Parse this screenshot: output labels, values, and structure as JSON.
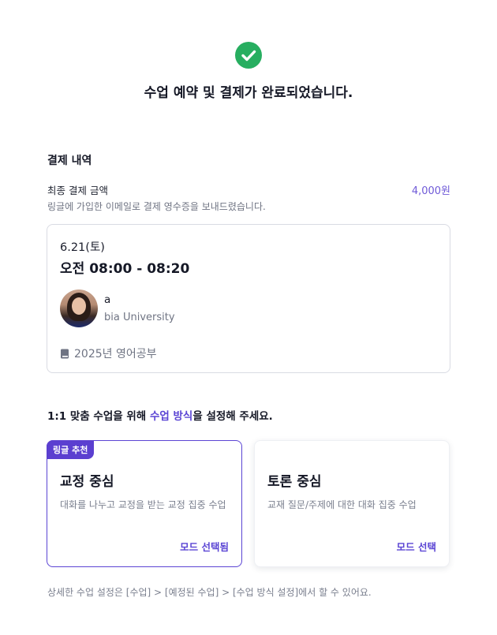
{
  "header": {
    "icon": "check-circle-icon",
    "title": "수업 예약 및 결제가 완료되었습니다."
  },
  "payment": {
    "section_title": "결제 내역",
    "final_label": "최종 결제 금액",
    "final_amount": "4,000원",
    "receipt_note": "링글에 가입한 이메일로 결제 영수증을 보내드렸습니다."
  },
  "lesson": {
    "date": "6.21(토)",
    "time": "오전 08:00 - 08:20",
    "tutor_name": "a",
    "tutor_school": "bia University",
    "course_icon": "book-icon",
    "course": "2025년 영어공부"
  },
  "mode_select": {
    "prompt_before": "1:1 맞춤 수업을 위해 ",
    "prompt_highlight": "수업 방식",
    "prompt_after": "을 설정해 주세요.",
    "cards": [
      {
        "badge": "링글 추천",
        "title": "교정 중심",
        "description": "대화를 나누고 교정을 받는 교정 집중 수업",
        "action": "모드 선택됨",
        "selected": true
      },
      {
        "title": "토론 중심",
        "description": "교재 질문/주제에 대한 대화 집중 수업",
        "action": "모드 선택",
        "selected": false
      }
    ]
  },
  "footer": {
    "note": "상세한 수업 설정은 [수업] > [예정된 수업] > [수업 방식 설정]에서 할 수 있어요."
  },
  "colors": {
    "accent": "#5b45d4",
    "success": "#27ae60",
    "amount": "#6f5ad8"
  }
}
